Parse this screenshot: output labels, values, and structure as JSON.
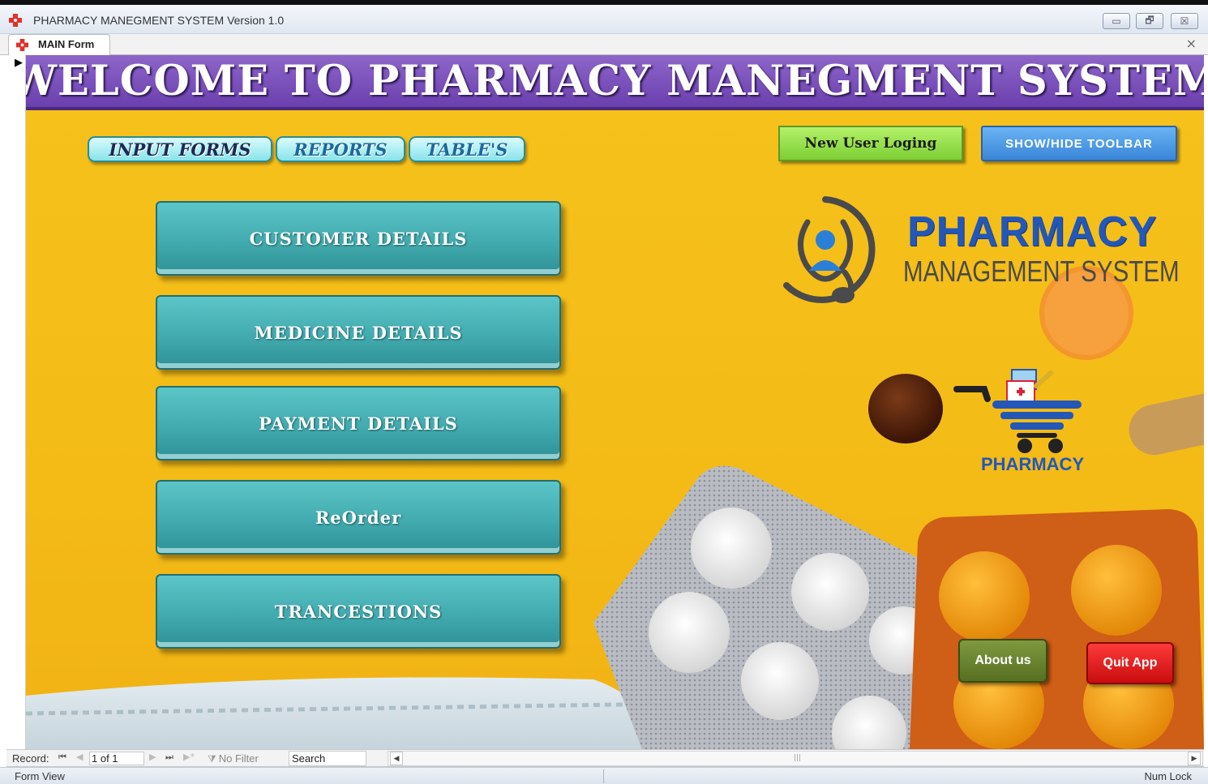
{
  "window": {
    "title": "PHARMACY MANEGMENT SYSTEM Version 1.0",
    "icon": "pharmacy-cross-icon",
    "controls": [
      "minimize-icon",
      "restore-icon",
      "close-icon"
    ]
  },
  "tab": {
    "label": "MAIN Form",
    "close_icon": "close-icon"
  },
  "form": {
    "title": "WELCOME TO PHARMACY MANEGMENT SYSTEM",
    "top_tabs": [
      "INPUT FORMS",
      "REPORTS",
      "TABLE'S"
    ],
    "new_user_label": "New User Loging",
    "toolbar_label": "SHOW/HIDE TOOLBAR",
    "nav_buttons": [
      "CUSTOMER DETAILS",
      "MEDICINE DETAILS",
      "PAYMENT DETAILS",
      "ReOrder",
      "TRANCESTIONS"
    ],
    "logo": {
      "word": "PHARMACY",
      "subtitle": "MANAGEMENT SYSTEM",
      "icon": "doctor-stethoscope-icon"
    },
    "cart": {
      "label": "PHARMACY",
      "icon": "pharmacy-cart-icon"
    },
    "about_label": "About us",
    "quit_label": "Quit App"
  },
  "record_nav": {
    "label": "Record:",
    "current": "1 of 1",
    "filter": "No Filter",
    "search": "Search"
  },
  "status": {
    "view": "Form View",
    "num_lock": "Num Lock"
  },
  "colors": {
    "form_background": "#f5be18",
    "title_bar": "#7a4fbd",
    "nav_button": "#42abaf",
    "new_user_button": "#8fd94a",
    "toolbar_button": "#3f8cdc",
    "about_button": "#607a2a",
    "quit_button": "#e01515",
    "logo_blue": "#2357b8"
  }
}
